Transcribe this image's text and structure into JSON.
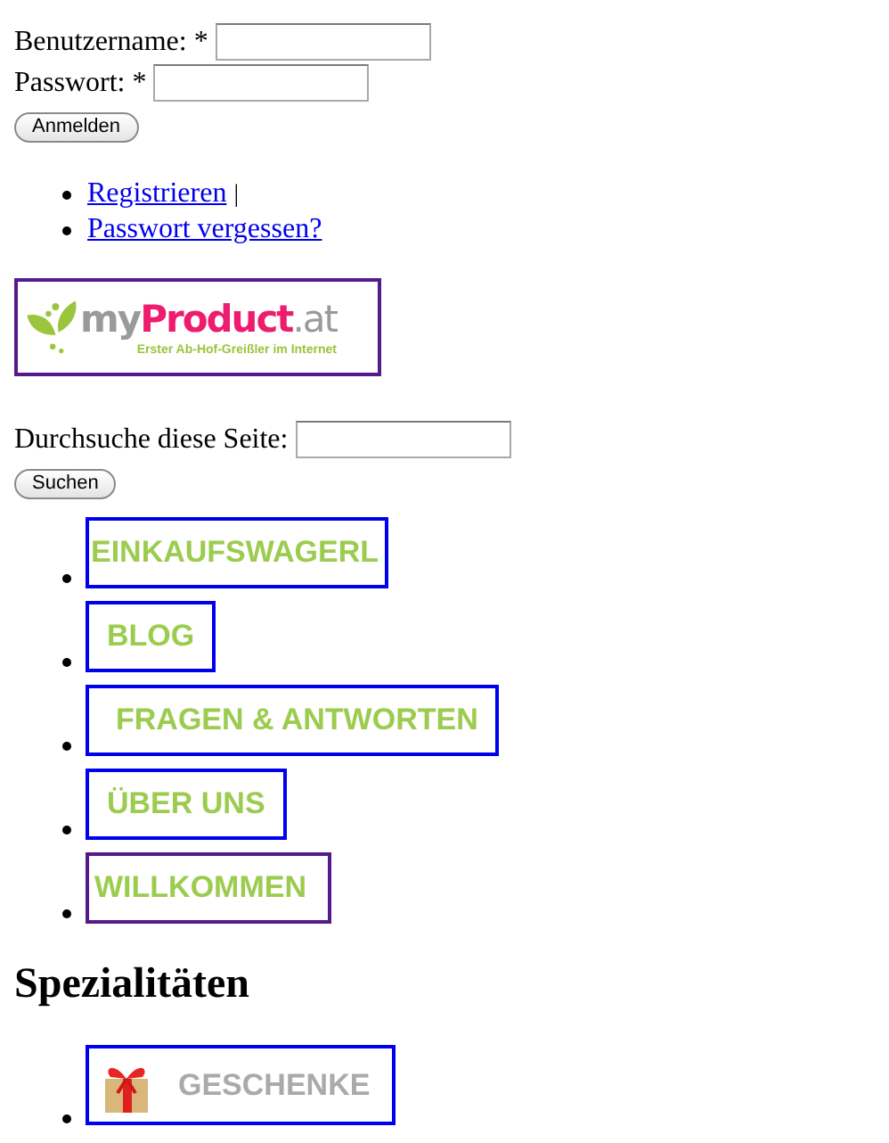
{
  "login_form": {
    "username_label": "Benutzername: *",
    "password_label": "Passwort: *",
    "submit": "Anmelden"
  },
  "user_links": [
    {
      "label": "Registrieren",
      "separator": "|"
    },
    {
      "label": "Passwort vergessen?"
    }
  ],
  "logo": {
    "name_parts": [
      "my",
      "Product",
      ".at"
    ],
    "tagline": "Erster Ab-Hof-Greißler im Internet",
    "visited": true
  },
  "search_form": {
    "label": "Durchsuche diese Seite:",
    "submit": "Suchen"
  },
  "nav": [
    {
      "label": "EINKAUFSWAGERL",
      "visited": false
    },
    {
      "label": "BLOG",
      "visited": false
    },
    {
      "label": "FRAGEN & ANTWORTEN",
      "visited": false
    },
    {
      "label": "ÜBER UNS",
      "visited": false
    },
    {
      "label": "WILLKOMMEN",
      "visited": true
    }
  ],
  "specialties": {
    "heading": "Spezialitäten",
    "items": [
      {
        "label": "GESCHENKE",
        "visited": false
      }
    ]
  }
}
